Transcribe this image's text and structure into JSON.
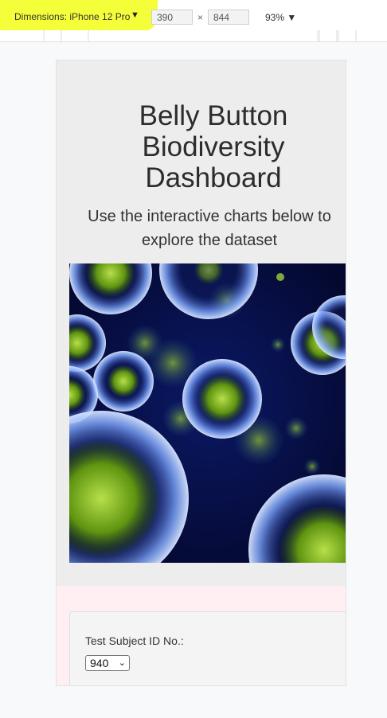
{
  "devtools": {
    "device_label": "Dimensions: iPhone 12 Pro",
    "device_caret": "▼",
    "width": "390",
    "times": "×",
    "height": "844",
    "zoom": "93% ▼"
  },
  "page": {
    "title": "Belly Button Biodiversity Dashboard",
    "subtitle": "Use the interactive charts below to explore the dataset",
    "hero_image": "microbe-illustration",
    "select_label": "Test Subject ID No.:",
    "select_value": "940",
    "select_caret": "⌄"
  },
  "colors": {
    "highlight": "#f4ff2e",
    "jumbotron": "#ededed",
    "pink_section": "#ffeef2",
    "hero_background": "#050a3a",
    "microbe_core": "#6a9e10",
    "microbe_shell": "#9fc3ff"
  }
}
